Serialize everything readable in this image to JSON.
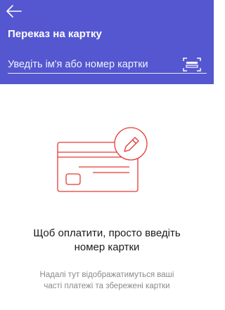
{
  "header": {
    "title": "Переказ на картку",
    "background_color": "#5557d0",
    "back_icon": "arrow-left-icon"
  },
  "search": {
    "placeholder": "Уведіть ім'я або номер картки",
    "value": "",
    "scan_icon": "card-scan-icon"
  },
  "empty_state": {
    "illustration_icon": "credit-card-edit-icon",
    "accent_color": "#e53935",
    "title_line1": "Щоб оплатити, просто введіть",
    "title_line2": "номер картки",
    "subtitle_line1": "Надалі тут відображатимуться ваші",
    "subtitle_line2": "часті платежі та збережені картки"
  }
}
